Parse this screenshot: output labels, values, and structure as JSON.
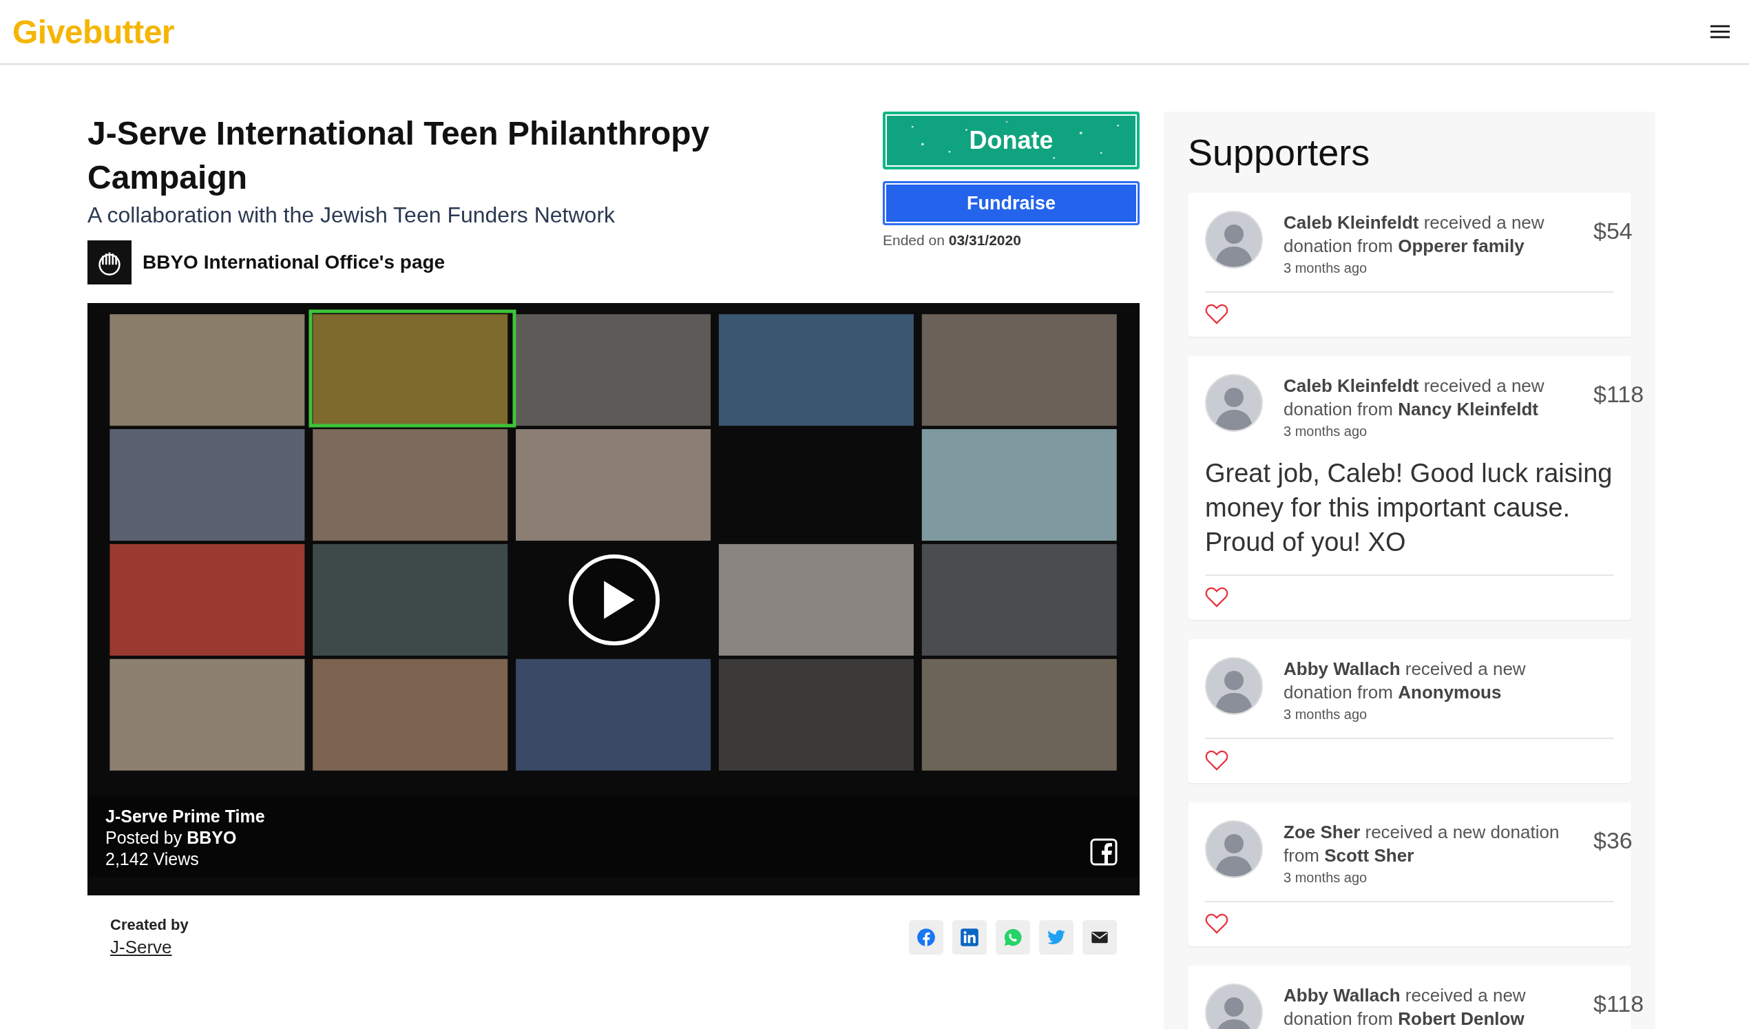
{
  "header": {
    "logo": "Givebutter"
  },
  "campaign": {
    "title": "J-Serve International Teen Philanthropy Campaign",
    "subtitle": "A collaboration with the Jewish Teen Funders Network",
    "organizer": "BBYO International Office's page"
  },
  "actions": {
    "donate": "Donate",
    "fundraise": "Fundraise",
    "ended": "Ended on **03/31/2020**"
  },
  "video": {
    "kind": "picture",
    "title": "J-Serve Prime Time",
    "posted": "Posted by **BBYO**",
    "views": "2,142 Views"
  },
  "creator": {
    "label": "Created by",
    "name": "J-Serve"
  },
  "supporters": {
    "heading": "Supporters",
    "items": [
      {
        "text": "**Caleb Kleinfeldt** received a new donation from **Opperer family**",
        "amount": "$54",
        "time": "3 months ago"
      },
      {
        "text": "**Caleb Kleinfeldt** received a new donation from **Nancy Kleinfeldt**",
        "amount": "$118",
        "time": "3 months ago",
        "message": "Great job, Caleb! Good luck raising money for this important cause. Proud of you! XO"
      },
      {
        "text": "**Abby Wallach** received a new donation from **Anonymous**",
        "time": "3 months ago"
      },
      {
        "text": "**Zoe Sher** received a new donation from **Scott Sher**",
        "amount": "$36",
        "time": "3 months ago"
      },
      {
        "text": "**Abby Wallach** received a new donation from **Robert Denlow**",
        "amount": "$118"
      }
    ]
  }
}
